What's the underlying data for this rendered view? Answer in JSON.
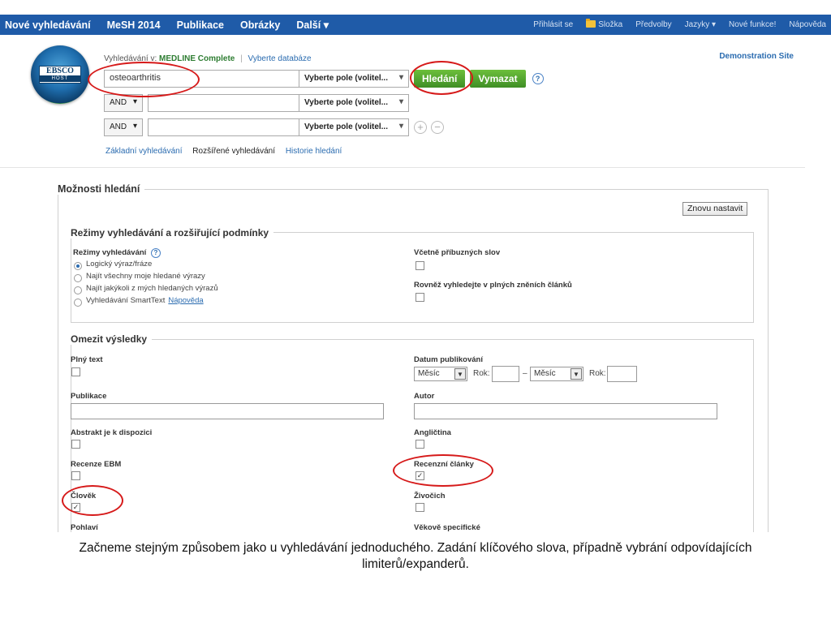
{
  "nav": {
    "left": [
      "Nové vyhledávání",
      "MeSH 2014",
      "Publikace",
      "Obrázky",
      "Další ▾"
    ],
    "right": [
      "Přihlásit se",
      "Složka",
      "Předvolby",
      "Jazyky ▾",
      "Nové funkce!",
      "Nápověda"
    ]
  },
  "logo": {
    "t1": "EBSCO",
    "t2": "HOST"
  },
  "search": {
    "db_prefix": "Vyhledávání v:",
    "db_name": "MEDLINE Complete",
    "choose_db": "Vyberte databáze",
    "demo_site": "Demonstration Site",
    "query": "osteoarthritis",
    "field_label": "Vyberte pole (volitel...",
    "search_button": "Hledání",
    "clear_button": "Vymazat",
    "help": "?",
    "bool_op": "AND",
    "plus": "+",
    "minus": "−",
    "links": [
      "Základní vyhledávání",
      "Rozšířené vyhledávání",
      "Historie hledání"
    ]
  },
  "options": {
    "title": "Možnosti hledání",
    "reset": "Znovu nastavit",
    "modes_title": "Režimy vyhledávání a rozšiřující podmínky",
    "modes_label": "Režimy vyhledávání",
    "modes": [
      "Logický výraz/fráze",
      "Najít všechny moje hledané výrazy",
      "Najít jakýkoli z mých hledaných výrazů",
      "Vyhledávání SmartText"
    ],
    "modes_help_link": "Nápověda",
    "related_words": "Včetně příbuzných slov",
    "fulltext_search": "Rovněž vyhledejte v plných zněních článků"
  },
  "limits": {
    "title": "Omezit výsledky",
    "full_text": "Plný text",
    "pub_date": "Datum publikování",
    "month": "Měsíc",
    "year": "Rok:",
    "dash": "–",
    "publication": "Publikace",
    "author": "Autor",
    "abstract": "Abstrakt je k dispozici",
    "english": "Angličtina",
    "ebm": "Recenze EBM",
    "review": "Recenzní články",
    "human": "Člověk",
    "animal": "Živočich",
    "sex": "Pohlaví",
    "age": "Věkově specifické",
    "checked_mark": "✓"
  },
  "caption": "Začneme stejným způsobem jako u vyhledávání jednoduchého. Zadání klíčového slova, případně vybrání odpovídajících limiterů/expanderů."
}
